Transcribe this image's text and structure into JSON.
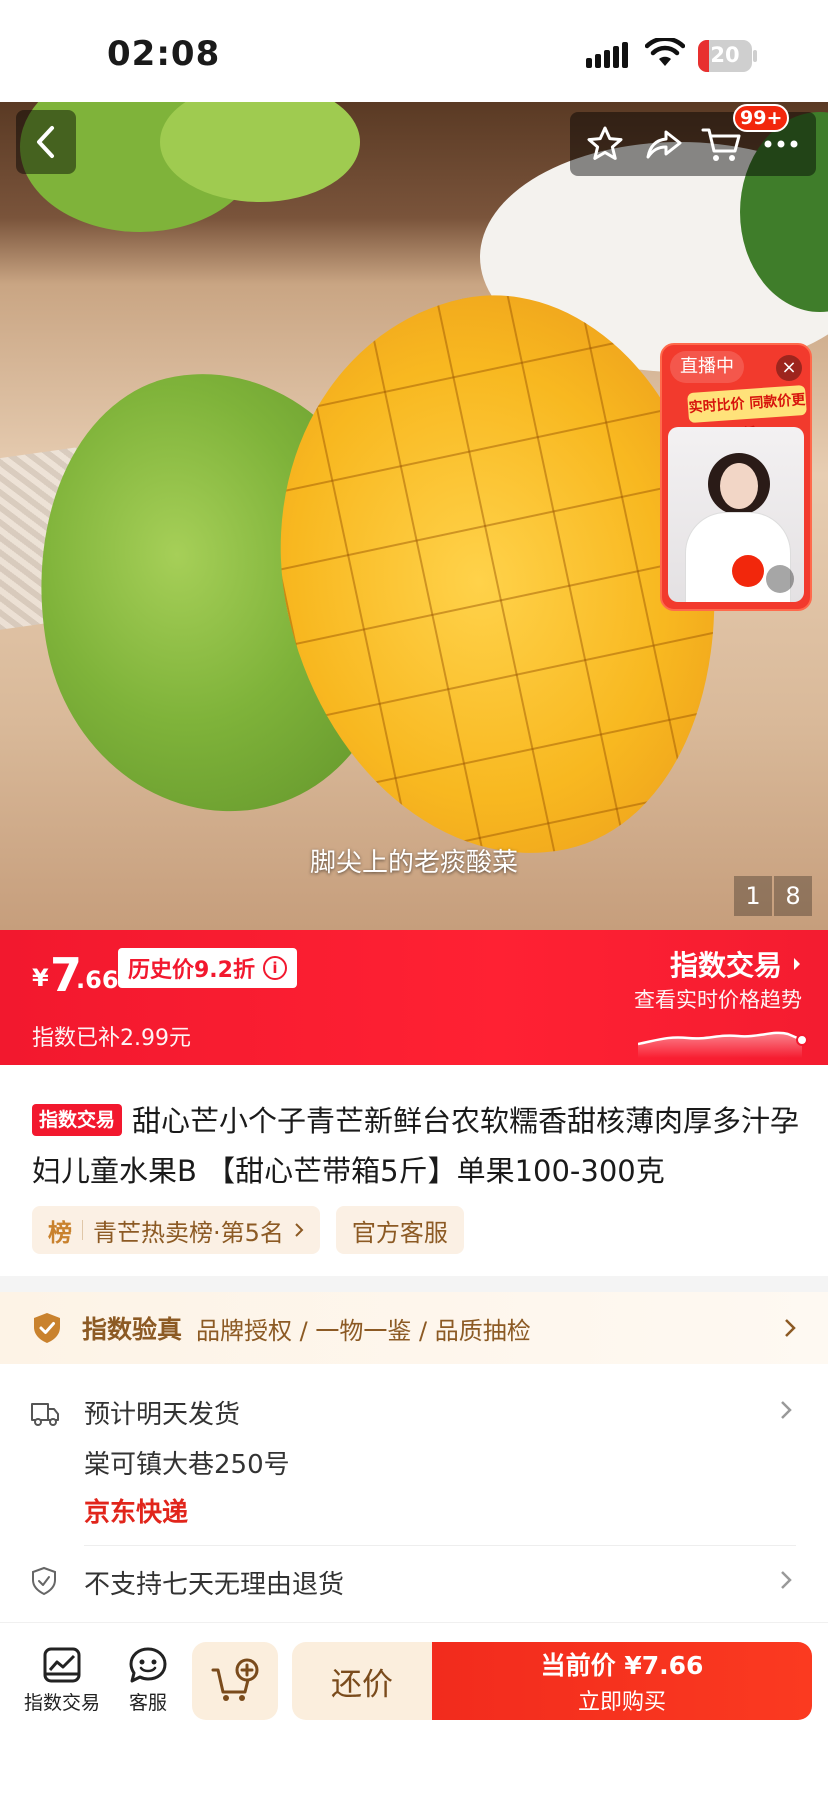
{
  "status_bar": {
    "time": "02:08",
    "battery": "20",
    "battery_level": 0.2
  },
  "header": {
    "cart_badge": "99+"
  },
  "hero": {
    "caption": "脚尖上的老痰酸菜",
    "page_current": "1",
    "page_total": "8"
  },
  "live": {
    "tag": "直播中",
    "banner": "实时比价 同款价更低",
    "close": "×"
  },
  "price": {
    "currency": "¥",
    "integer": "7",
    "decimal": ".66",
    "history_label": "历史价9.2折",
    "info_icon": "i",
    "subsidy": "指数已补2.99元",
    "index_title": "指数交易",
    "index_sub": "查看实时价格趋势"
  },
  "product": {
    "tag": "指数交易",
    "title": "甜心芒小个子青芒新鲜台农软糯香甜核薄肉厚多汁孕妇儿童水果B 【甜心芒带箱5斤】单果100-300克",
    "rank_badge": "榜",
    "rank_text": "青芒热卖榜·第5名",
    "service_chip": "官方客服"
  },
  "verify": {
    "title": "指数验真",
    "desc": "品牌授权 / 一物一鉴 / 品质抽检"
  },
  "shipping": {
    "line1": "预计明天发货",
    "line2": "棠可镇大巷250号",
    "carrier": "京东快递"
  },
  "returns": {
    "text": "不支持七天无理由退货"
  },
  "bottom_bar": {
    "index_trade": "指数交易",
    "service": "客服",
    "bargain": "还价",
    "buy_price": "当前价 ¥7.66",
    "buy_now": "立即购买"
  },
  "colors": {
    "brand_red": "#f2182e",
    "gold": "#8c5a24",
    "cream": "#fbeedd"
  }
}
